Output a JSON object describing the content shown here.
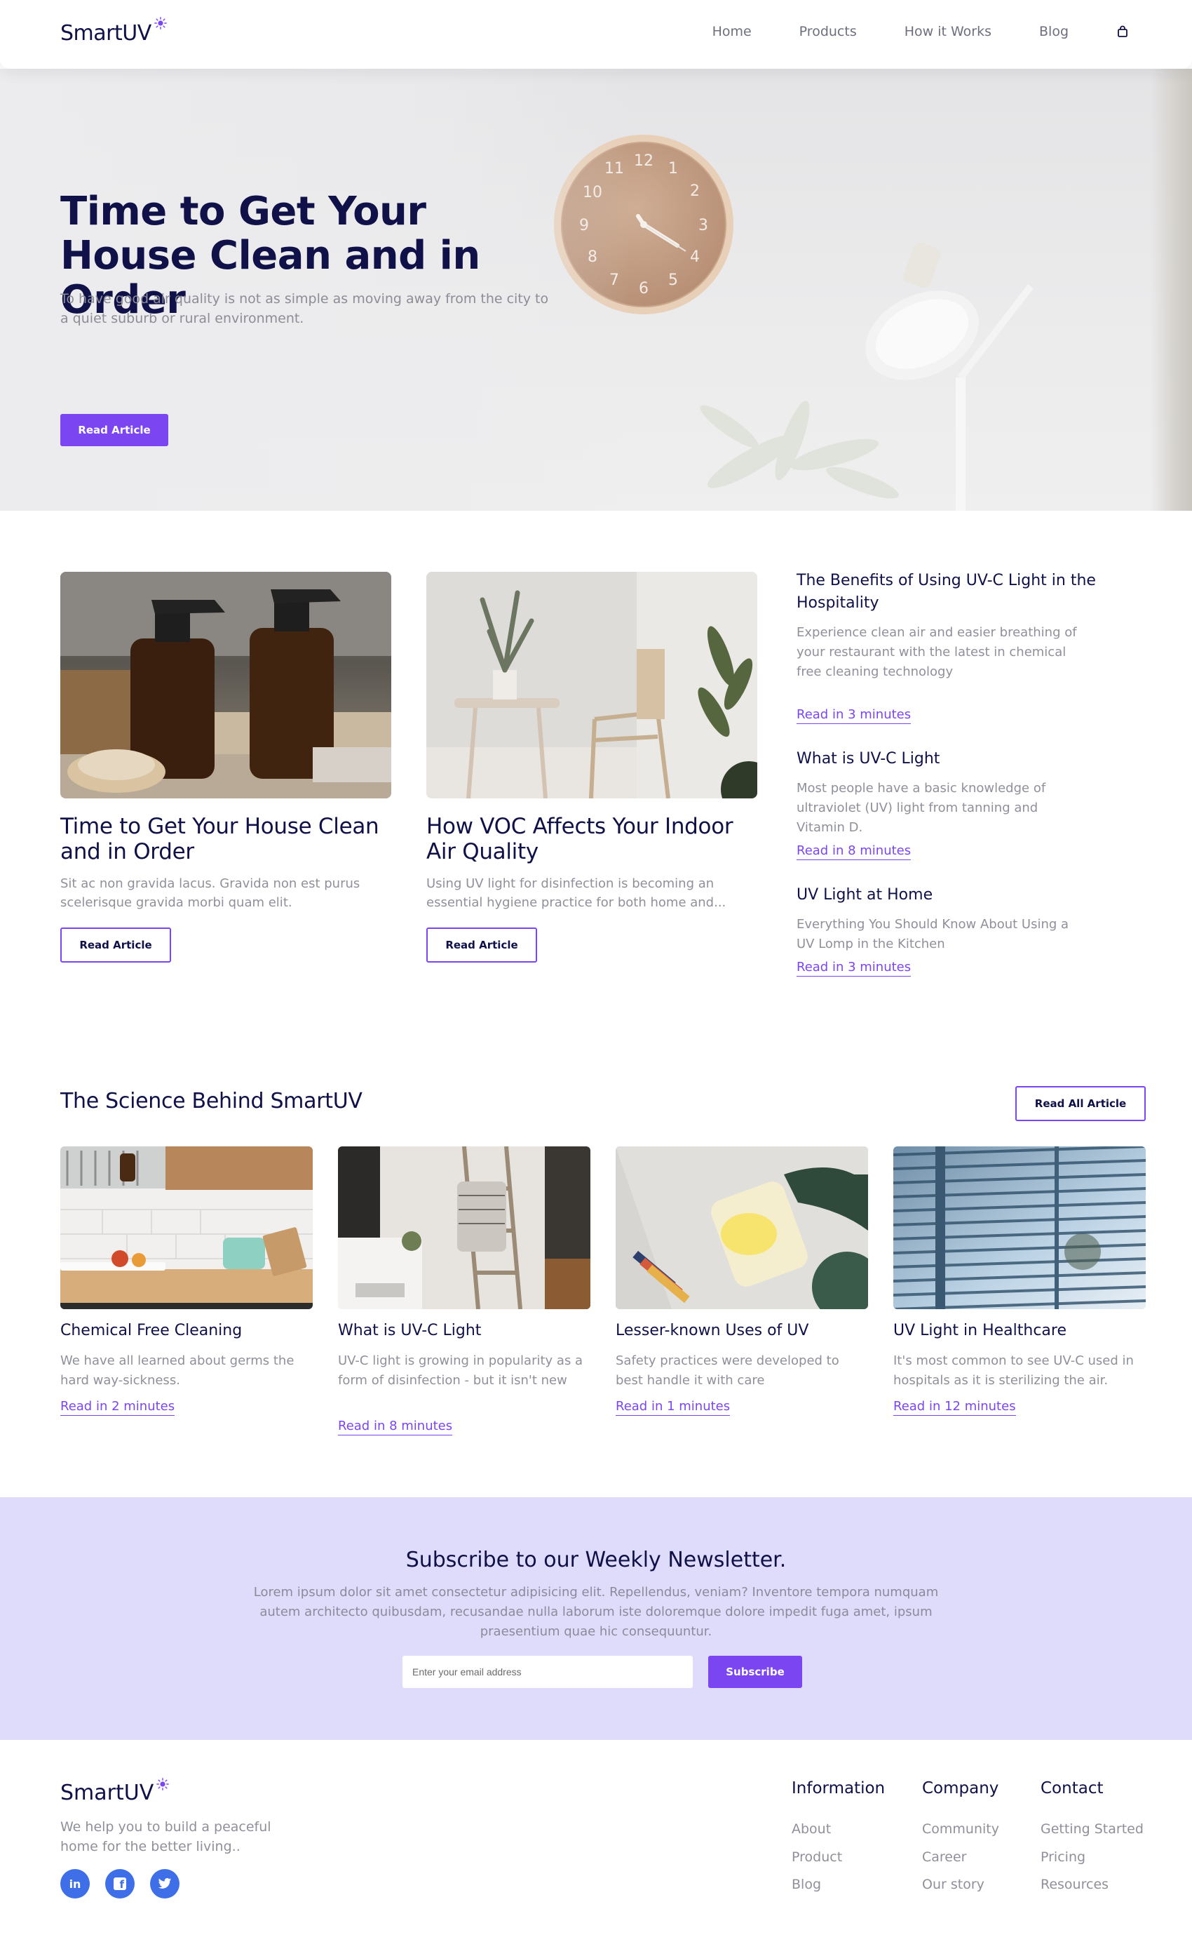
{
  "brand": {
    "name": "SmartUV",
    "accent": "#7b45f2",
    "navy": "#0f1148"
  },
  "nav": {
    "links": [
      "Home",
      "Products",
      "How it Works",
      "Blog"
    ],
    "cart_icon": "cart-icon"
  },
  "hero": {
    "title": "Time to Get Your House Clean and in Order",
    "subtitle": "To have good air quality is not as simple as moving away from the city to a quiet suburb or rural environment.",
    "button": "Read Article"
  },
  "featured": [
    {
      "title": "Time to Get Your House Clean and in Order",
      "text": "Sit ac non gravida lacus. Gravida non est purus scelerisque gravida morbi quam elit.",
      "button": "Read Article"
    },
    {
      "title": "How VOC Affects Your Indoor Air Quality",
      "text": "Using UV light for disinfection is becoming an essential hygiene practice for both home and...",
      "button": "Read Article"
    }
  ],
  "side_articles": [
    {
      "title": "The Benefits of Using UV-C Light in the Hospitality",
      "text": "Experience clean air and easier breathing of your restaurant with the latest in chemical free cleaning technology",
      "link": "Read in 3 minutes"
    },
    {
      "title": "What is UV-C Light",
      "text": "Most people have a basic knowledge of ultraviolet (UV) light from tanning and Vitamin D.",
      "link": "Read in 8 minutes"
    },
    {
      "title": "UV Light at Home",
      "text": "Everything You Should Know About Using a UV Lomp in the Kitchen",
      "link": "Read in 3 minutes"
    }
  ],
  "science": {
    "title": "The Science Behind SmartUV",
    "button": "Read All Article",
    "cards": [
      {
        "title": "Chemical Free Cleaning",
        "text": "We have all learned about germs the hard way-sickness.",
        "link": "Read in 2 minutes"
      },
      {
        "title": "What is UV-C Light",
        "text": "UV-C light is growing in popularity as a form of disinfection - but it isn't new",
        "link": "Read in 8 minutes"
      },
      {
        "title": "Lesser-known Uses of UV",
        "text": "Safety practices were developed to best handle it with care",
        "link": "Read in 1 minutes"
      },
      {
        "title": "UV Light in Healthcare",
        "text": "It's most common to see UV-C used in hospitals as it is sterilizing the air.",
        "link": "Read in 12 minutes"
      }
    ]
  },
  "newsletter": {
    "title": "Subscribe to our Weekly Newsletter.",
    "text": "Lorem ipsum dolor sit amet consectetur adipisicing elit. Repellendus, veniam? Inventore tempora numquam autem architecto quibusdam, recusandae nulla laborum iste doloremque dolore impedit fuga amet, ipsum praesentium quae hic consequuntur.",
    "placeholder": "Enter your email address",
    "button": "Subscribe"
  },
  "footer": {
    "tagline": "We help you to build a peaceful home for the better living..",
    "social": [
      {
        "icon": "linkedin-icon",
        "glyph": "in"
      },
      {
        "icon": "facebook-icon",
        "glyph": "f"
      },
      {
        "icon": "twitter-icon",
        "glyph": "t"
      }
    ],
    "columns": [
      {
        "title": "Information",
        "links": [
          "About",
          "Product",
          "Blog"
        ]
      },
      {
        "title": "Company",
        "links": [
          "Community",
          "Career",
          "Our story"
        ]
      },
      {
        "title": "Contact",
        "links": [
          "Getting Started",
          "Pricing",
          "Resources"
        ]
      }
    ]
  }
}
